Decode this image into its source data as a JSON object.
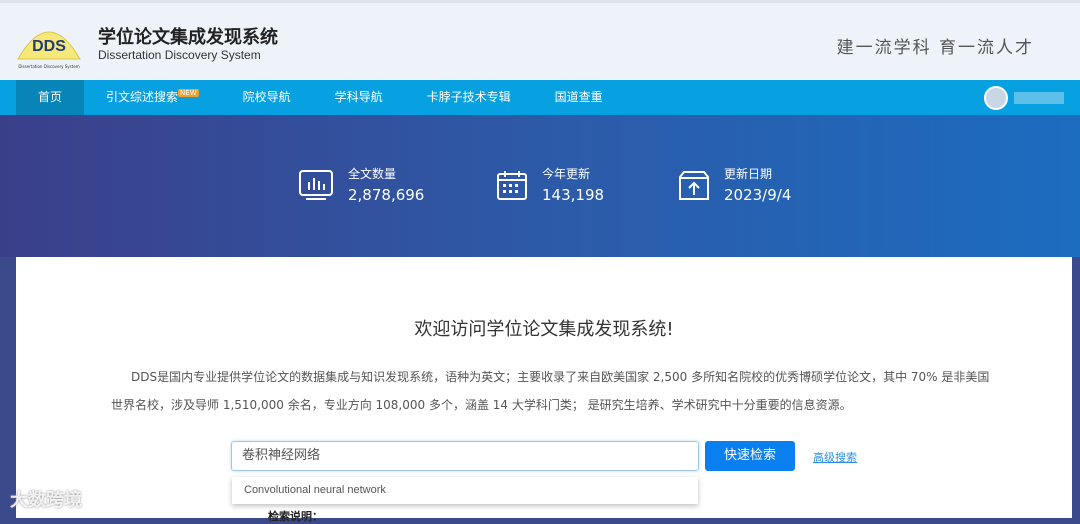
{
  "header": {
    "logo_text": "DDS",
    "logo_sub": "Dissertation Discovery System",
    "title": "学位论文集成发现系统",
    "subtitle": "Dissertation Discovery System",
    "slogan": "建一流学科 育一流人才"
  },
  "nav": {
    "items": [
      "首页",
      "引文综述搜索",
      "院校导航",
      "学科导航",
      "卡脖子技术专辑",
      "国道查重"
    ],
    "new_badge": "NEW"
  },
  "stats": [
    {
      "label": "全文数量",
      "value": "2,878,696",
      "icon": "bar-chart-icon"
    },
    {
      "label": "今年更新",
      "value": "143,198",
      "icon": "calendar-icon"
    },
    {
      "label": "更新日期",
      "value": "2023/9/4",
      "icon": "upload-icon"
    }
  ],
  "main": {
    "welcome": "欢迎访问学位论文集成发现系统!",
    "description": "DDS是国内专业提供学位论文的数据集成与知识发现系统，语种为英文；主要收录了来自欧美国家 2,500 多所知名院校的优秀博硕学位论文，其中 70% 是非美国世界名校，涉及导师 1,510,000 余名，专业方向 108,000 多个，涵盖 14 大学科门类； 是研究生培养、学术研究中十分重要的信息资源。",
    "search_value": "卷积神经网络",
    "search_button": "快速检索",
    "advanced": "高级搜索",
    "suggestion": "Convolutional neural network",
    "help": "检索说明："
  },
  "watermark": "大数跨境"
}
